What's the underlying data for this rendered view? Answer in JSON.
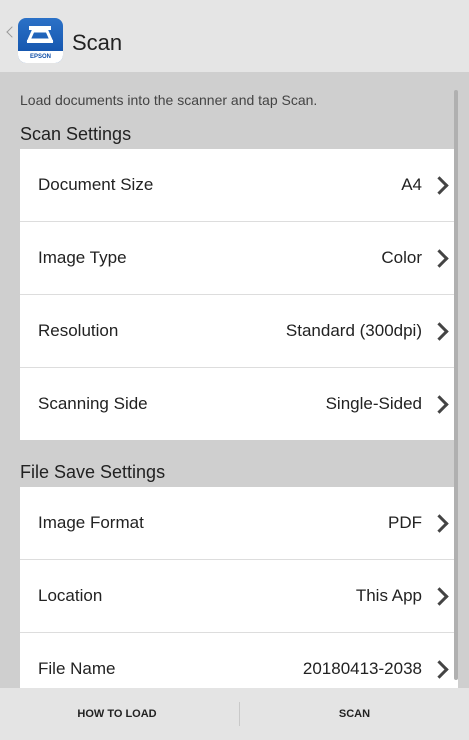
{
  "app": {
    "title": "Scan",
    "logo_text": "EPSON",
    "colors": {
      "appbar_bg": "#e5e5e5",
      "content_bg": "#cfcfcf",
      "logo_blue": "#1f63bd",
      "chevron": "#444444"
    }
  },
  "hint": "Load documents into the scanner and tap Scan.",
  "scan_settings": {
    "title": "Scan Settings",
    "rows": [
      {
        "label": "Document Size",
        "value": "A4"
      },
      {
        "label": "Image Type",
        "value": "Color"
      },
      {
        "label": "Resolution",
        "value": "Standard (300dpi)"
      },
      {
        "label": "Scanning Side",
        "value": "Single-Sided"
      }
    ]
  },
  "file_save_settings": {
    "title": "File Save Settings",
    "rows": [
      {
        "label": "Image Format",
        "value": "PDF"
      },
      {
        "label": "Location",
        "value": "This App"
      },
      {
        "label": "File Name",
        "value": "20180413-2038"
      }
    ]
  },
  "bottom_bar": {
    "how_to_load": "HOW TO LOAD",
    "scan": "SCAN"
  }
}
